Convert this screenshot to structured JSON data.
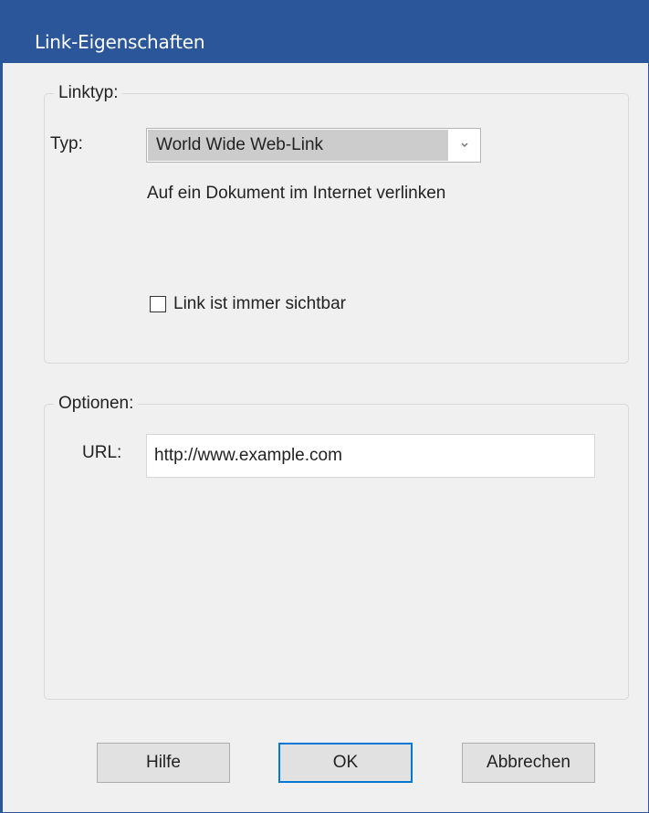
{
  "window": {
    "title": "Link-Eigenschaften"
  },
  "linktype_group": {
    "legend": "Linktyp:",
    "type_label": "Typ:",
    "type_value": "World Wide Web-Link",
    "description": "Auf ein Dokument im Internet verlinken",
    "always_visible_label": "Link ist immer sichtbar",
    "always_visible_checked": false
  },
  "options_group": {
    "legend": "Optionen:",
    "url_label": "URL:",
    "url_value": "http://www.example.com"
  },
  "buttons": {
    "help": "Hilfe",
    "ok": "OK",
    "cancel": "Abbrechen"
  },
  "colors": {
    "titlebar": "#2b579a",
    "background": "#f0f0f0",
    "default_button_border": "#0078d7"
  },
  "icons": {
    "dropdown": "chevron-down-icon"
  }
}
